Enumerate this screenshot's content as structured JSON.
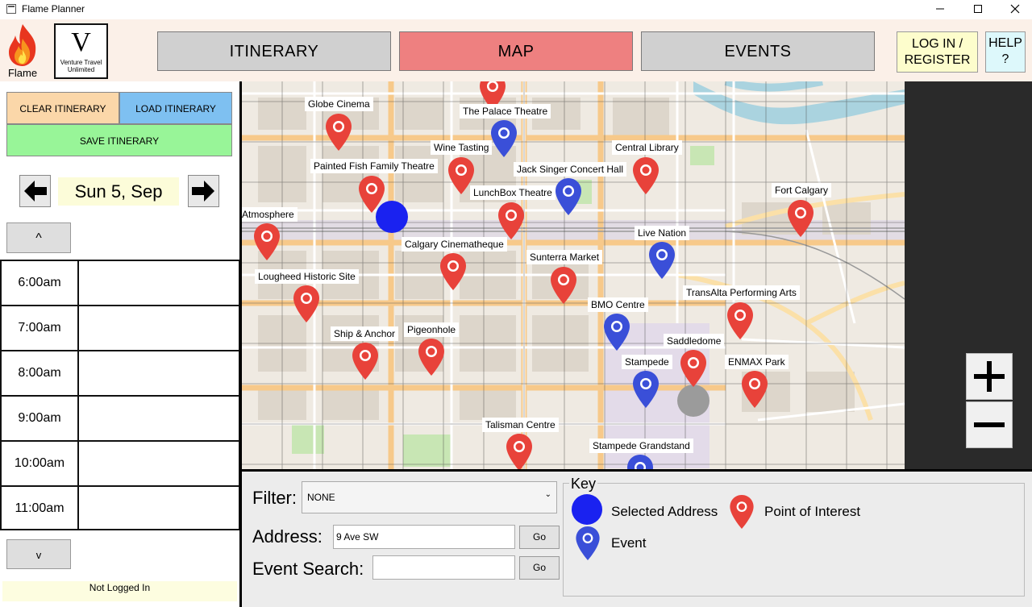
{
  "window": {
    "title": "Flame Planner"
  },
  "brand": {
    "flame_label": "Flame",
    "partner_initial": "V",
    "partner_line1": "Venture Travel",
    "partner_line2": "Unlimited"
  },
  "nav": {
    "itinerary": "ITINERARY",
    "map": "MAP",
    "events": "EVENTS",
    "active": "MAP",
    "login_line1": "LOG IN /",
    "login_line2": "REGISTER",
    "help_line1": "HELP",
    "help_line2": "?"
  },
  "itinerary_panel": {
    "clear_label": "CLEAR ITINERARY",
    "load_label": "LOAD ITINERARY",
    "save_label": "SAVE ITINERARY",
    "date": "Sun 5, Sep",
    "scroll_up": "^",
    "scroll_down": "v",
    "slots": [
      {
        "time": "6:00am",
        "item": ""
      },
      {
        "time": "7:00am",
        "item": ""
      },
      {
        "time": "8:00am",
        "item": ""
      },
      {
        "time": "9:00am",
        "item": ""
      },
      {
        "time": "10:00am",
        "item": ""
      },
      {
        "time": "11:00am",
        "item": ""
      }
    ],
    "status": "Not Logged In"
  },
  "map": {
    "colors": {
      "poi": "#e8423a",
      "event": "#3a4fd8",
      "selected": "#1a22f0"
    },
    "labels": {
      "globe_cinema": "Globe Cinema",
      "palace_theatre": "The Palace Theatre",
      "wine_tasting": "Wine Tasting",
      "central_library": "Central Library",
      "painted_fish": "Painted Fish Family Theatre",
      "jack_singer": "Jack Singer Concert Hall",
      "fort_calgary": "Fort Calgary",
      "lunchbox": "LunchBox Theatre",
      "atmosphere": "Atmosphere",
      "live_nation": "Live Nation",
      "calgary_cinematheque": "Calgary Cinematheque",
      "sunterra": "Sunterra Market",
      "lougheed": "Lougheed Historic Site",
      "transalta": "TransAlta Performing Arts",
      "bmo_centre": "BMO Centre",
      "ship_anchor": "Ship & Anchor",
      "pigeonhole": "Pigeonhole",
      "saddledome": "Saddledome",
      "stampede": "Stampede",
      "enmax_park": "ENMAX Park",
      "talisman": "Talisman Centre",
      "stampede_grandstand": "Stampede Grandstand"
    },
    "zoom_in": "+",
    "zoom_out": "−"
  },
  "controls": {
    "filter_label": "Filter:",
    "filter_value": "NONE",
    "address_label": "Address:",
    "address_value": "9 Ave SW",
    "event_search_label": "Event Search:",
    "event_search_value": "",
    "go_label": "Go"
  },
  "key": {
    "title": "Key",
    "selected_address": "Selected Address",
    "point_of_interest": "Point of Interest",
    "event": "Event"
  }
}
